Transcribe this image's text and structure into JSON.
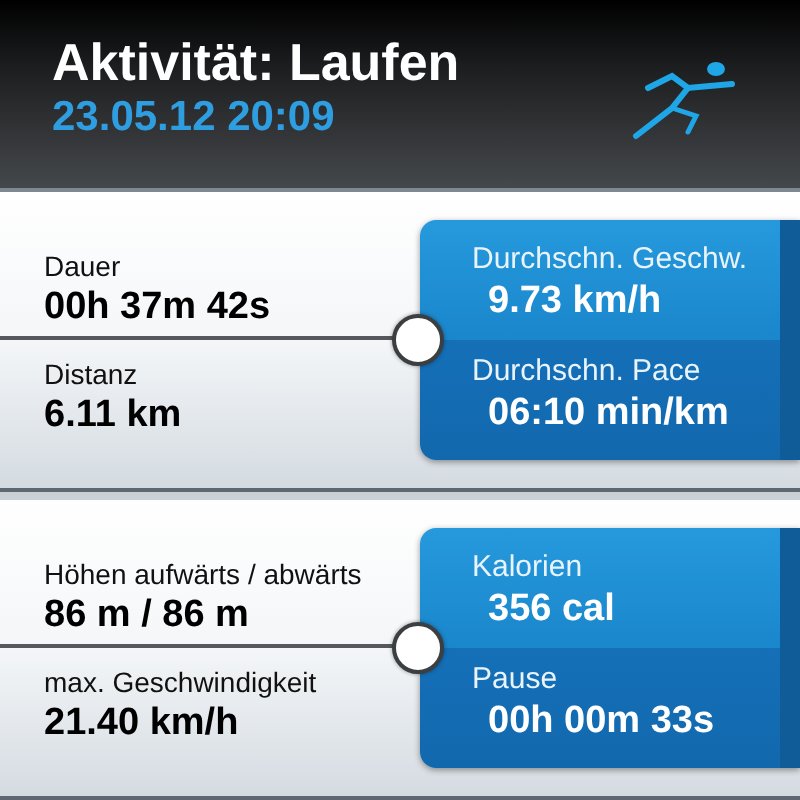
{
  "header": {
    "title": "Aktivität: Laufen",
    "datetime": "23.05.12 20:09"
  },
  "panels": [
    {
      "left": [
        {
          "label": "Dauer",
          "value": "00h 37m 42s"
        },
        {
          "label": "Distanz",
          "value": "6.11 km"
        }
      ],
      "right": [
        {
          "label": "Durchschn. Geschw.",
          "value": "9.73 km/h"
        },
        {
          "label": "Durchschn. Pace",
          "value": "06:10 min/km"
        }
      ]
    },
    {
      "left": [
        {
          "label": "Höhen aufwärts / abwärts",
          "value": "86 m / 86 m"
        },
        {
          "label": "max. Geschwindigkeit",
          "value": "21.40 km/h"
        }
      ],
      "right": [
        {
          "label": "Kalorien",
          "value": "356 cal"
        },
        {
          "label": "Pause",
          "value": "00h 00m 33s"
        }
      ]
    }
  ]
}
